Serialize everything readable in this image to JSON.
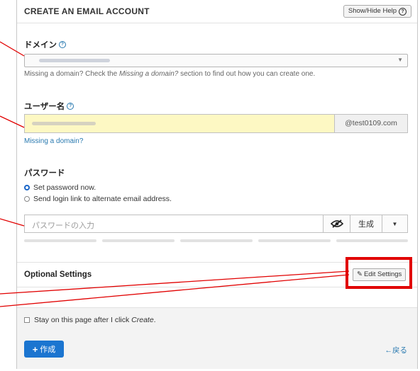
{
  "header": {
    "title": "CREATE AN EMAIL ACCOUNT",
    "help_button": "Show/Hide Help",
    "help_icon": "question-circle-icon"
  },
  "domain": {
    "label": "ドメイン",
    "help_text_prefix": "Missing a domain? Check the ",
    "help_text_em": "Missing a domain?",
    "help_text_suffix": " section to find out how you can create one."
  },
  "username": {
    "label": "ユーザー名",
    "domain_addon": "@test0109.com",
    "missing_link": "Missing a domain?"
  },
  "password": {
    "label": "パスワード",
    "options": [
      {
        "label": "Set password now.",
        "selected": true
      },
      {
        "label": "Send login link to alternate email address.",
        "selected": false
      }
    ],
    "placeholder": "パスワードの入力",
    "generate_label": "生成",
    "strength_segments": 5
  },
  "optional": {
    "title": "Optional Settings",
    "edit_button": "Edit Settings"
  },
  "footer": {
    "stay_prefix": "Stay on this page after I click ",
    "stay_em": "Create",
    "stay_suffix": ".",
    "create_button": "作成",
    "back_link": "戻る"
  },
  "colors": {
    "accent": "#1b75d0",
    "link": "#2a7ab0",
    "annotation": "#e10000",
    "username_bg": "#fdf8c3"
  }
}
